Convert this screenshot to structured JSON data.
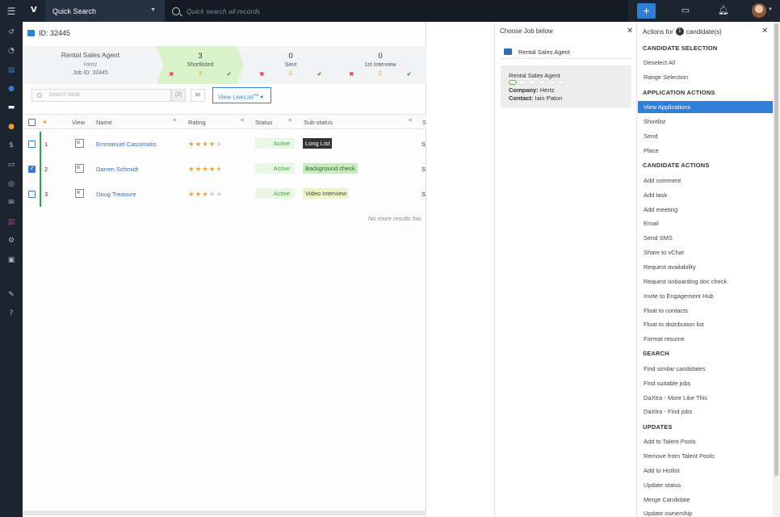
{
  "topbar": {
    "logo": "V",
    "quick_search_label": "Quick Search",
    "search_placeholder": "Quick search all records",
    "plus_label": "+"
  },
  "sidebar": {
    "icons": [
      "history-icon",
      "dashboard-icon",
      "notes-icon",
      "contacts-icon",
      "jobs-icon",
      "candidates-icon",
      "finance-icon",
      "placements-icon",
      "tasks-icon",
      "mail-icon",
      "reports-icon",
      "settings-icon",
      "courses-icon",
      "edit-icon",
      "help-icon"
    ]
  },
  "job": {
    "id_label": "ID: 32445",
    "title": "Rental Sales Agent",
    "company": "Hertz",
    "job_id": "Job ID: 32445"
  },
  "pipeline": [
    {
      "count": "3",
      "label": "Shortlisted",
      "rejected": "✖",
      "pending": "3",
      "accepted": "✔"
    },
    {
      "count": "0",
      "label": "Sent",
      "rejected": "✖",
      "pending": "0",
      "accepted": "✔"
    },
    {
      "count": "0",
      "label": "1st Interview",
      "rejected": "✖",
      "pending": "0",
      "accepted": "✔"
    }
  ],
  "toolbar": {
    "search_placeholder": "Search table",
    "count": "(3)",
    "livelist_label": "View LiveList",
    "livelist_tm": "TM"
  },
  "table": {
    "headers": {
      "view": "View",
      "name": "Name",
      "rating": "Rating",
      "status": "Status",
      "substatus": "Sub-status",
      "extra": "S"
    },
    "rows": [
      {
        "num": "1",
        "name": "Emmanuel Cassimatis",
        "rating": 4,
        "status": "Active",
        "substatus": "Long List",
        "extra": "S",
        "checked": false
      },
      {
        "num": "2",
        "name": "Darren Schmidt",
        "rating": 4.5,
        "status": "Active",
        "substatus": "Background check",
        "extra": "S",
        "checked": true
      },
      {
        "num": "3",
        "name": "Doug Treasure",
        "rating": 3,
        "status": "Active",
        "substatus": "Video Interview",
        "extra": "S",
        "checked": false
      }
    ],
    "no_more": "No more results fou"
  },
  "job_panel": {
    "title": "Choose Job below",
    "search_value": "Rental Sales Agent",
    "card": {
      "title": "Rental Sales Agent",
      "company_label": "Company:",
      "company": "Hertz",
      "contact_label": "Contact:",
      "contact": "Iain Paton"
    }
  },
  "actions": {
    "title_prefix": "Actions for",
    "count": "1",
    "title_suffix": "candidate(s)",
    "sections": [
      {
        "heading": "CANDIDATE SELECTION",
        "items": [
          "Deselect All",
          "Range Selection"
        ]
      },
      {
        "heading": "APPLICATION ACTIONS",
        "items": [
          "View Applications",
          "Shortlist",
          "Send",
          "Place"
        ]
      },
      {
        "heading": "CANDIDATE ACTIONS",
        "items": [
          "Add comment",
          "Add task",
          "Add meeting",
          "Email",
          "Send SMS",
          "Share to vChat",
          "Request availability",
          "Request onboarding doc check",
          "Invite to Engagement Hub",
          "Float to contacts",
          "Float to distribution list",
          "Format resume"
        ]
      },
      {
        "heading": "SEARCH",
        "items": [
          "Find similar candidates",
          "Find suitable jobs",
          "DaXtra - More Like This",
          "DaXtra - Find jobs"
        ]
      },
      {
        "heading": "UPDATES",
        "items": [
          "Add to Talent Pools",
          "Remove from Talent Pools",
          "Add to Hotlist",
          "Update status",
          "Merge Candidate",
          "Update ownership"
        ]
      }
    ],
    "selected": "View Applications"
  },
  "colors": {
    "accent": "#2f7fd6",
    "topbar": "#1c2430",
    "active_green": "#46a046",
    "star": "#f2a02a"
  }
}
